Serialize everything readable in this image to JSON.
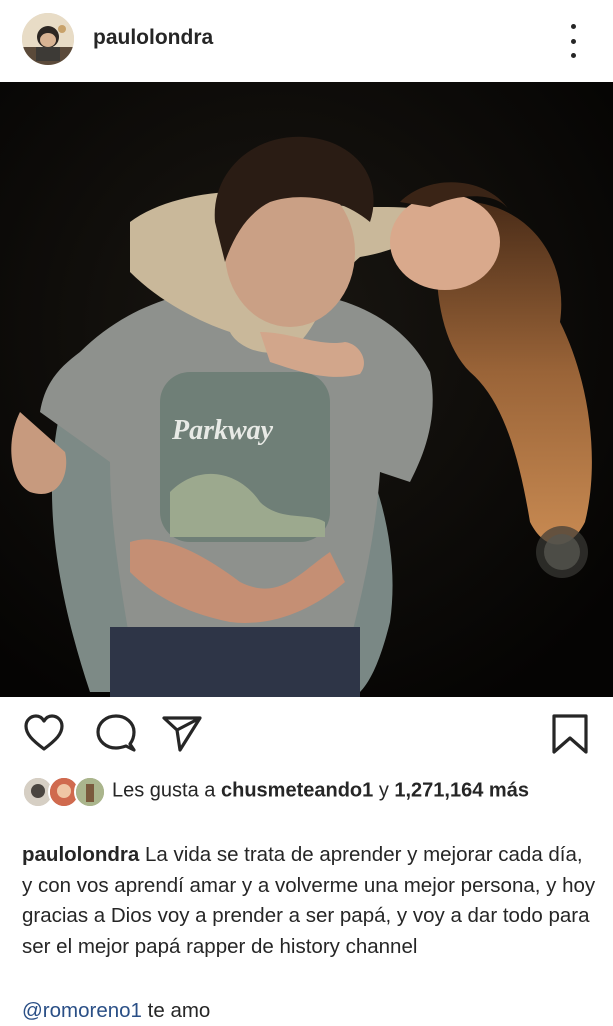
{
  "post": {
    "username": "paulolondra"
  },
  "icons": {
    "like": "heart-icon",
    "comment": "comment-icon",
    "share": "paper-plane-icon",
    "save": "bookmark-icon",
    "more": "more-vertical-icon"
  },
  "likes": {
    "prefix": "Les gusta a",
    "user": "chusmeteando1",
    "joiner": "y",
    "count": "1,271,164",
    "suffix": "más"
  },
  "caption": {
    "username": "paulolondra",
    "text": "La vida se trata de aprender y mejorar cada día, y con vos aprendí amar y a volverme una mejor persona, y hoy gracias a Dios voy a prender a ser papá, y voy a dar todo para ser el mejor papá rapper de history channel"
  },
  "comment": {
    "mention": "@romoreno1",
    "text": "te amo"
  },
  "photo": {
    "shirt_text": "Parkway"
  }
}
